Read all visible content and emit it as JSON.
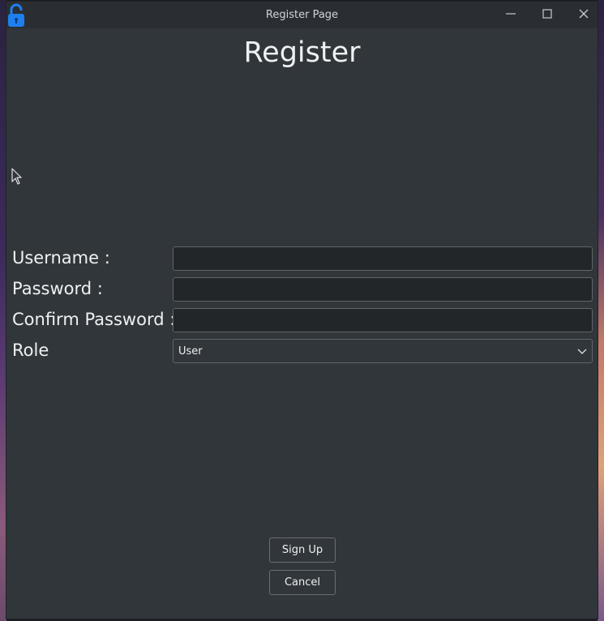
{
  "window": {
    "title": "Register Page",
    "app_icon": "unlocked-padlock-icon",
    "controls": {
      "minimize_icon": "minimize-icon",
      "maximize_icon": "maximize-icon",
      "close_icon": "close-icon"
    }
  },
  "form": {
    "heading": "Register",
    "username_label": "Username :",
    "username_value": "",
    "password_label": "Password :",
    "password_value": "",
    "confirm_label": "Confirm Password :",
    "confirm_value": "",
    "role_label": "Role",
    "role_selected": "User"
  },
  "actions": {
    "signup_label": "Sign Up",
    "cancel_label": "Cancel"
  },
  "colors": {
    "window_bg": "#31363b",
    "titlebar_bg": "#2a2e32",
    "input_bg": "#232629",
    "accent_icon": "#1d7ff0",
    "text": "#eff0f1"
  }
}
